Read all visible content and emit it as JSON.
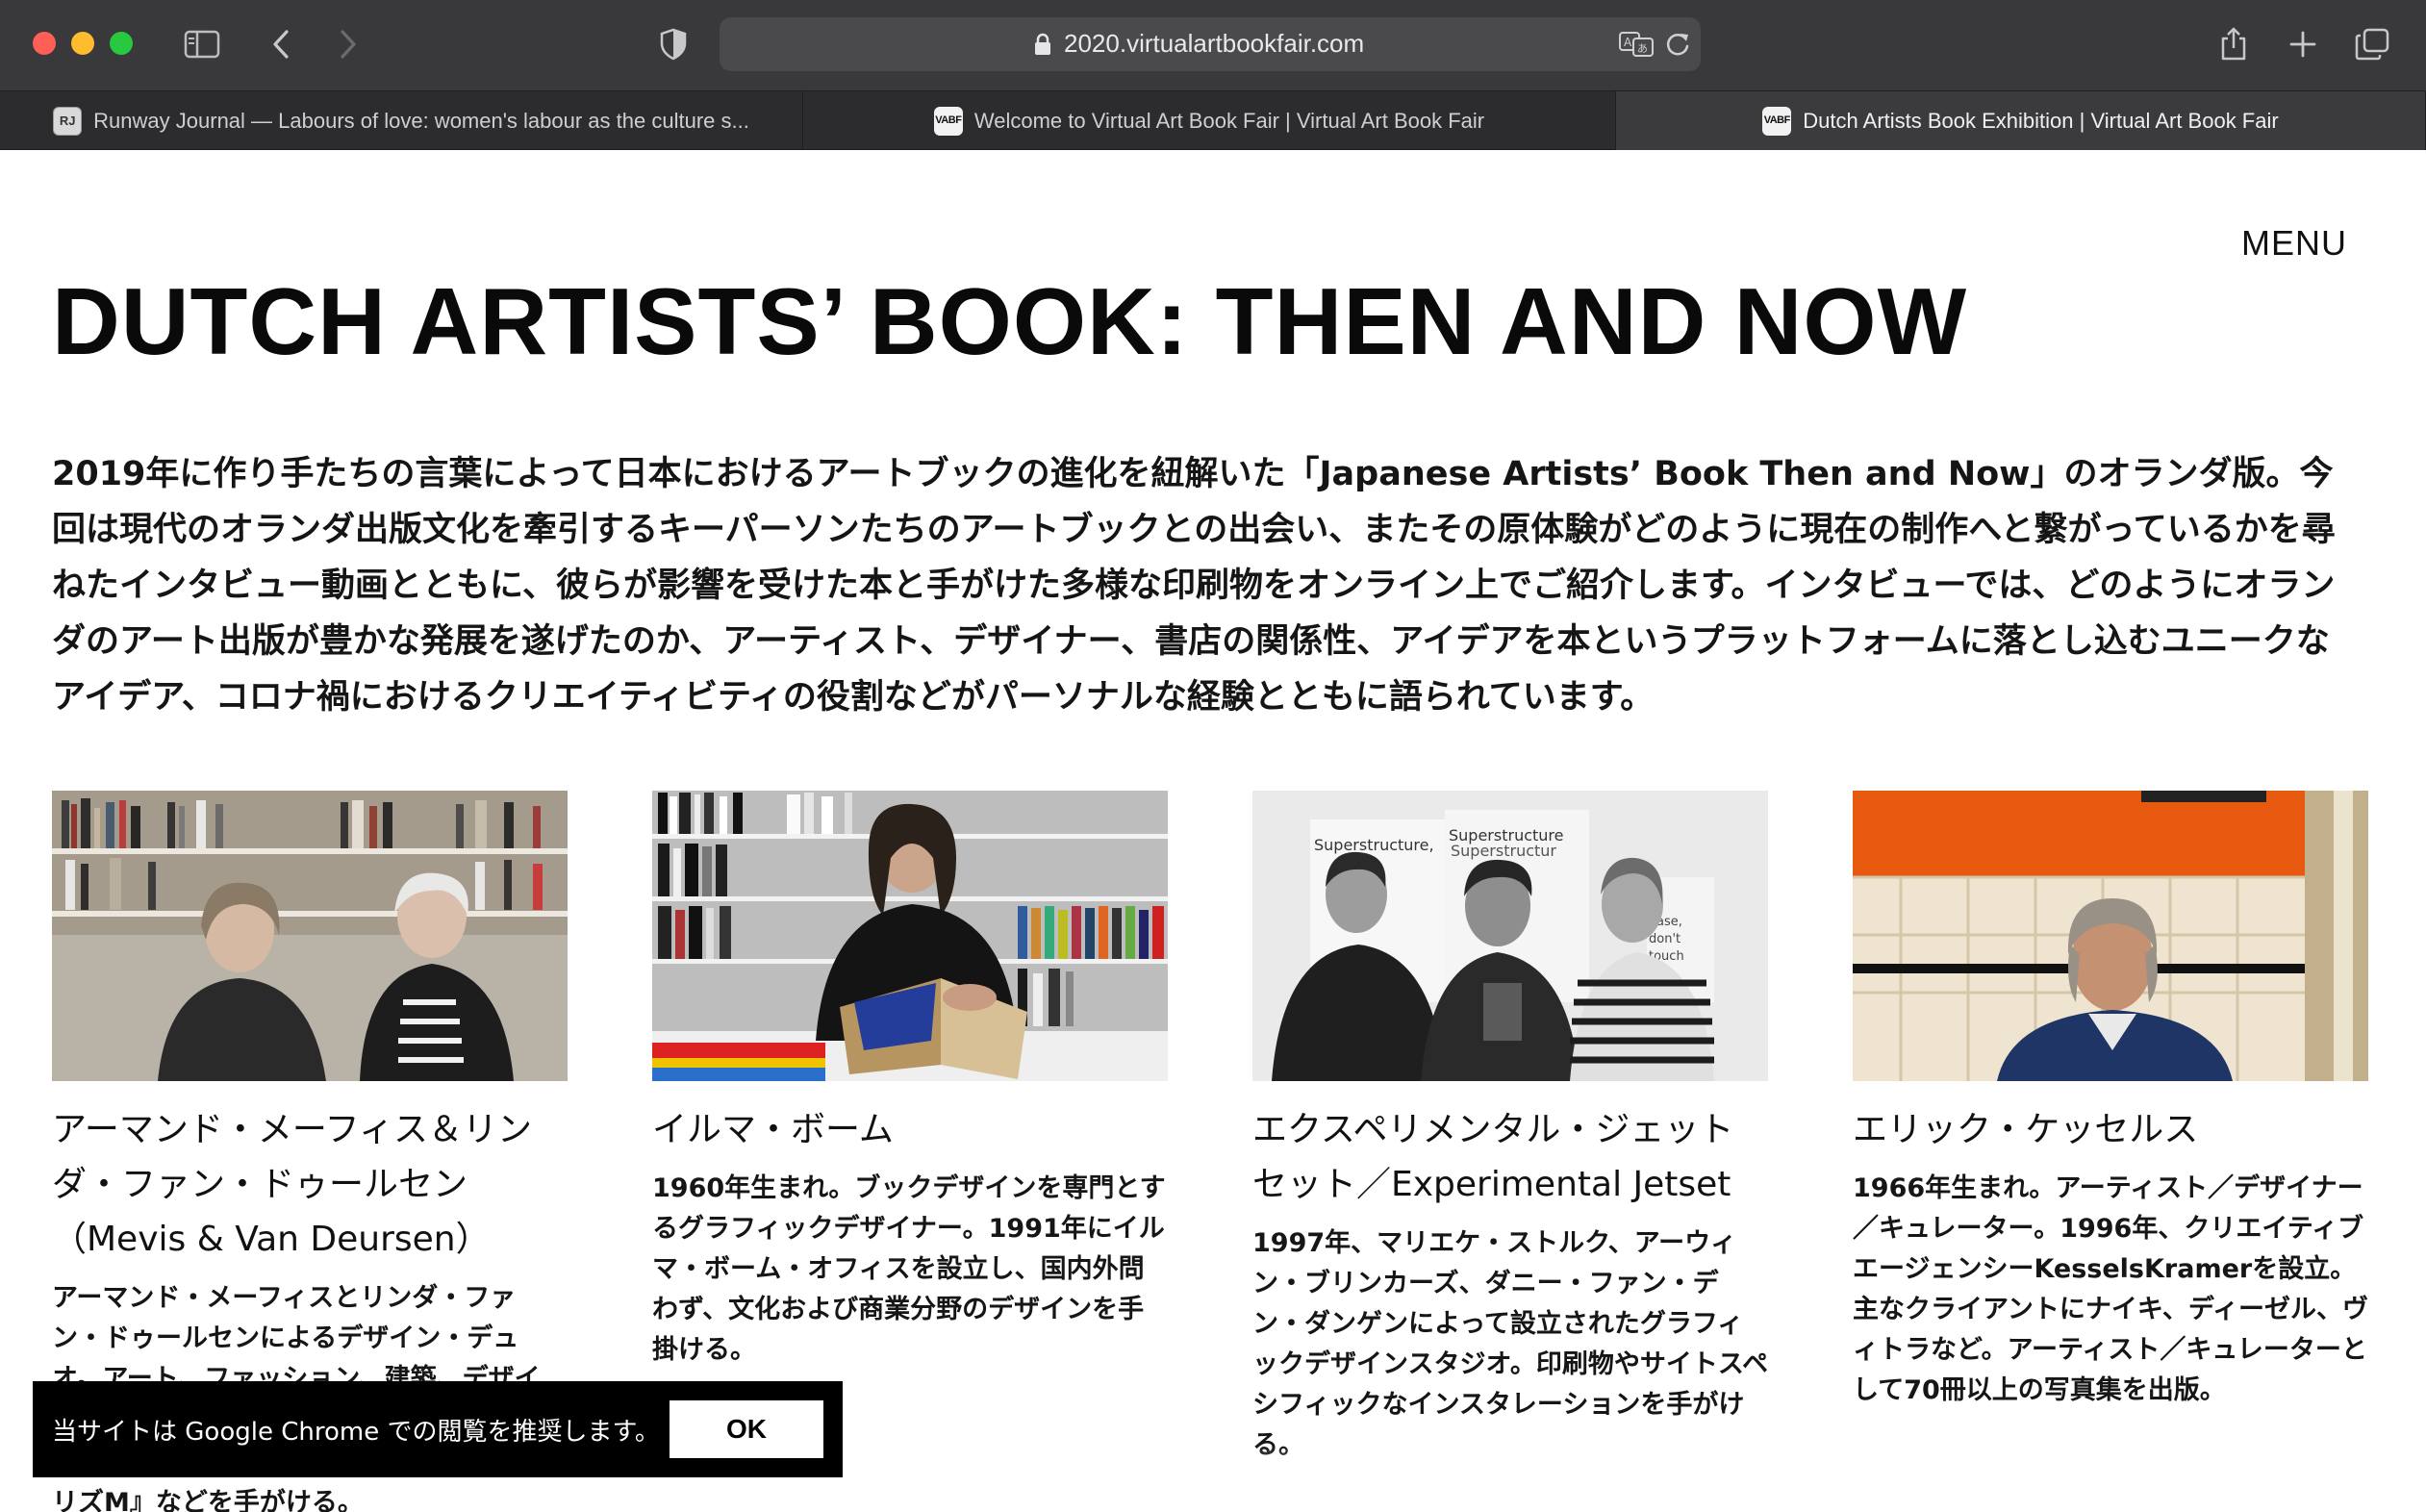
{
  "browser": {
    "url": "2020.virtualartbookfair.com",
    "tabs": [
      {
        "favicon": "RJ",
        "title": "Runway Journal — Labours of love: women's labour as the culture s...",
        "active": false
      },
      {
        "favicon": "VABF",
        "title": "Welcome to Virtual Art Book Fair | Virtual Art Book Fair",
        "active": false
      },
      {
        "favicon": "VABF",
        "title": "Dutch Artists Book Exhibition | Virtual Art Book Fair",
        "active": true
      }
    ]
  },
  "page": {
    "menu": "MENU",
    "title": "DUTCH ARTISTS’ BOOK: THEN AND NOW",
    "intro": "2019年に作り手たちの言葉によって日本におけるアートブックの進化を紐解いた「Japanese Artists’ Book Then and Now」のオランダ版。今回は現代のオランダ出版文化を牽引するキーパーソンたちのアートブックとの出会い、またその原体験がどのように現在の制作へと繋がっているかを尋ねたインタビュー動画とともに、彼らが影響を受けた本と手がけた多様な印刷物をオンライン上でご紹介します。インタビューでは、どのようにオランダのアート出版が豊かな発展を遂げたのか、アーティスト、デザイナー、書店の関係性、アイデアを本というプラットフォームに落とし込むユニークなアイデア、コロナ禍におけるクリエイティビティの役割などがパーソナルな経験とともに語られています。",
    "cards": [
      {
        "name": "アーマンド・メーフィス＆リンダ・ファン・ドゥールセン（Mevis & Van Deursen）",
        "desc": "アーマンド・メーフィスとリンダ・ファン・ドゥールセンによるデザイン・デュオ。アート、ファッション、建築、デザイ"
      },
      {
        "name": "イルマ・ボーム",
        "desc": "1960年生まれ。ブックデザインを専門とするグラフィックデザイナー。1991年にイルマ・ボーム・オフィスを設立し、国内外問わず、文化および商業分野のデザインを手掛ける。"
      },
      {
        "name": "エクスペリメンタル・ジェットセット／Experimental Jetset",
        "desc": "1997年、マリエケ・ストルク、アーウィン・ブリンカーズ、ダニー・ファン・デン・ダンゲンによって設立されたグラフィックデザインスタジオ。印刷物やサイトスペシフィックなインスタレーションを手がける。"
      },
      {
        "name": "エリック・ケッセルス",
        "desc": "1966年生まれ。アーティスト／デザイナー／キュレーター。1996年、クリエイティブエージェンシーKesselsKramerを設立。主なクライアントにナイキ、ディーゼル、ヴィトラなど。アーティスト／キュレーターとして70冊以上の写真集を出版。"
      }
    ],
    "peek_text": "リズM』などを手がける。"
  },
  "notice": {
    "text": "当サイトは Google Chrome での閲覧を推奨します。",
    "ok": "OK"
  },
  "colors": {
    "toolbar": "#39393b",
    "tabbar": "#2c2c2e",
    "active_tab": "#3b3b3e",
    "notice_bg": "#000000"
  }
}
